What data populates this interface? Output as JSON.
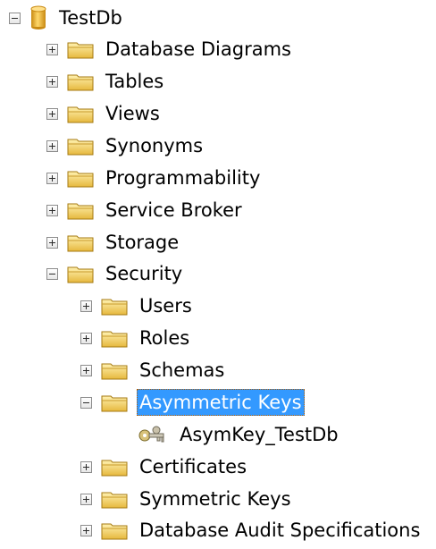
{
  "tree": {
    "root": {
      "label": "TestDb",
      "icon": "database-icon",
      "expanded": true
    },
    "items": [
      {
        "label": "Database Diagrams",
        "icon": "folder-icon",
        "expanded": false
      },
      {
        "label": "Tables",
        "icon": "folder-icon",
        "expanded": false
      },
      {
        "label": "Views",
        "icon": "folder-icon",
        "expanded": false
      },
      {
        "label": "Synonyms",
        "icon": "folder-icon",
        "expanded": false
      },
      {
        "label": "Programmability",
        "icon": "folder-icon",
        "expanded": false
      },
      {
        "label": "Service Broker",
        "icon": "folder-icon",
        "expanded": false
      },
      {
        "label": "Storage",
        "icon": "folder-icon",
        "expanded": false
      },
      {
        "label": "Security",
        "icon": "folder-icon",
        "expanded": true
      }
    ],
    "security_children": [
      {
        "label": "Users",
        "icon": "folder-icon",
        "expanded": false
      },
      {
        "label": "Roles",
        "icon": "folder-icon",
        "expanded": false
      },
      {
        "label": "Schemas",
        "icon": "folder-icon",
        "expanded": false
      },
      {
        "label": "Asymmetric Keys",
        "icon": "folder-icon",
        "expanded": true,
        "selected": true
      },
      {
        "label": "Certificates",
        "icon": "folder-icon",
        "expanded": false
      },
      {
        "label": "Symmetric Keys",
        "icon": "folder-icon",
        "expanded": false
      },
      {
        "label": "Database Audit Specifications",
        "icon": "folder-icon",
        "expanded": false
      }
    ],
    "asymmetric_key_children": [
      {
        "label": "AsymKey_TestDb",
        "icon": "asymmetric-key-icon"
      }
    ]
  },
  "colors": {
    "selection_background": "#3399ff",
    "selection_text": "#ffffff",
    "folder_fill": "#f5d36a",
    "database_fill": "#f2b632"
  }
}
